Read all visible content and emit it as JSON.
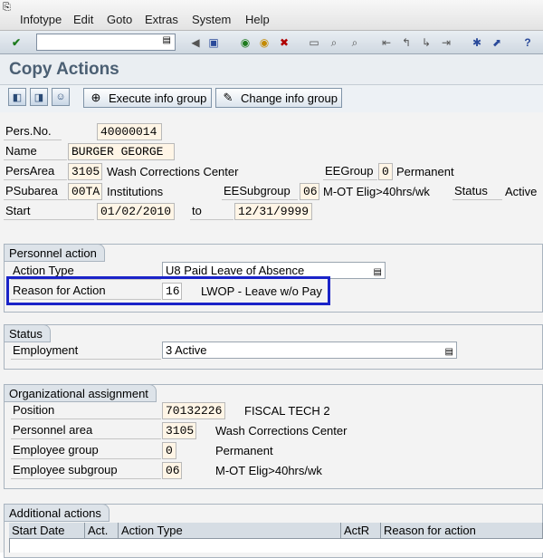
{
  "menubar": {
    "items": [
      "Infotype",
      "Edit",
      "Goto",
      "Extras",
      "System",
      "Help"
    ]
  },
  "toolbar": {
    "icons": [
      "enter-icon",
      "save-icon",
      "back-icon",
      "exit-icon",
      "cancel-icon",
      "print-icon",
      "find-icon",
      "find-next-icon",
      "first-page-icon",
      "prev-page-icon",
      "next-page-icon",
      "last-page-icon",
      "create-session-icon",
      "shortcut-icon",
      "help-icon"
    ]
  },
  "page": {
    "title": "Copy Actions"
  },
  "app_toolbar": {
    "execute_label": "Execute info group",
    "change_label": "Change info group"
  },
  "header": {
    "persno_label": "Pers.No.",
    "persno_value": "40000014",
    "name_label": "Name",
    "name_value": "BURGER GEORGE",
    "persarea_label": "PersArea",
    "persarea_code": "3105",
    "persarea_text": "Wash Corrections Center",
    "eegroup_label": "EEGroup",
    "eegroup_code": "0",
    "eegroup_text": "Permanent",
    "psubarea_label": "PSubarea",
    "psubarea_code": "00TA",
    "psubarea_text": "Institutions",
    "eesubgroup_label": "EESubgroup",
    "eesubgroup_code": "06",
    "eesubgroup_text": "M-OT Elig>40hrs/wk",
    "status_label": "Status",
    "status_value": "Active",
    "start_label": "Start",
    "start_value": "01/02/2010",
    "to_label": "to",
    "to_value": "12/31/9999"
  },
  "personnel_action": {
    "title": "Personnel action",
    "action_type_label": "Action Type",
    "action_type_value": "U8 Paid Leave of Absence",
    "reason_label": "Reason for Action",
    "reason_code": "16",
    "reason_text": "LWOP - Leave w/o Pay"
  },
  "status_group": {
    "title": "Status",
    "employment_label": "Employment",
    "employment_value": "3 Active"
  },
  "org_assignment": {
    "title": "Organizational assignment",
    "position_label": "Position",
    "position_code": "70132226",
    "position_text": "FISCAL TECH 2",
    "persarea_label": "Personnel area",
    "persarea_code": "3105",
    "persarea_text": "Wash Corrections Center",
    "eegroup_label": "Employee group",
    "eegroup_code": "0",
    "eegroup_text": "Permanent",
    "eesubgroup_label": "Employee subgroup",
    "eesubgroup_code": "06",
    "eesubgroup_text": "M-OT Elig>40hrs/wk"
  },
  "additional_actions": {
    "title": "Additional actions",
    "columns": [
      "Start Date",
      "Act.",
      "Action Type",
      "ActR",
      "Reason for action"
    ]
  }
}
